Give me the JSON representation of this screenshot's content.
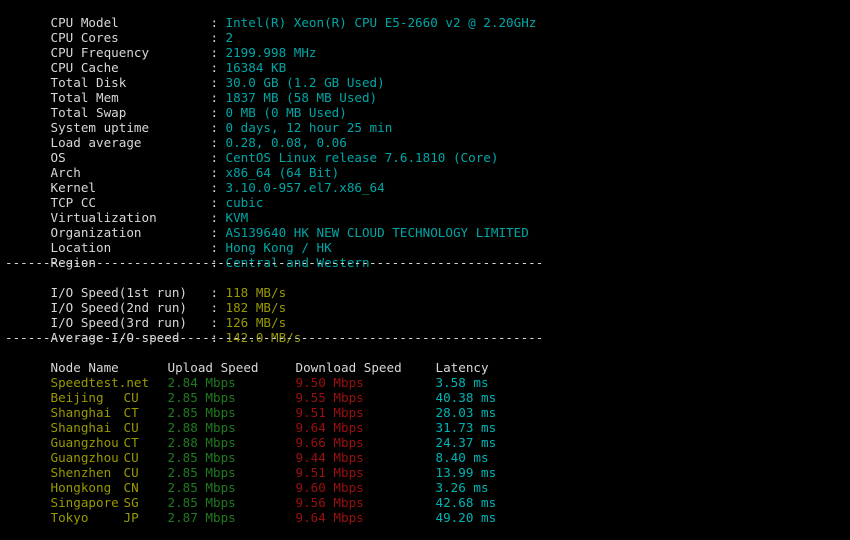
{
  "terminal": {
    "background": "#000000",
    "foreground": "#d8d8d8",
    "colors": {
      "label": "#d8d8d8",
      "info_value": "#00a6a6",
      "io_value": "#999900",
      "node_name": "#999900",
      "upload": "#1f7a1f",
      "download": "#9a0f0f",
      "latency": "#00b3b3",
      "separator": "#d8d8d8"
    }
  },
  "separator": "-----------------------------------------------------------------------",
  "system_info": {
    "separator_label": "colon",
    "rows": [
      {
        "label": "CPU Model",
        "colon": ":",
        "value": "Intel(R) Xeon(R) CPU E5-2660 v2 @ 2.20GHz"
      },
      {
        "label": "CPU Cores",
        "colon": ":",
        "value": "2"
      },
      {
        "label": "CPU Frequency",
        "colon": ":",
        "value": "2199.998 MHz"
      },
      {
        "label": "CPU Cache",
        "colon": ":",
        "value": "16384 KB"
      },
      {
        "label": "Total Disk",
        "colon": ":",
        "value": "30.0 GB (1.2 GB Used)"
      },
      {
        "label": "Total Mem",
        "colon": ":",
        "value": "1837 MB (58 MB Used)"
      },
      {
        "label": "Total Swap",
        "colon": ":",
        "value": "0 MB (0 MB Used)"
      },
      {
        "label": "System uptime",
        "colon": ":",
        "value": "0 days, 12 hour 25 min"
      },
      {
        "label": "Load average",
        "colon": ":",
        "value": "0.28, 0.08, 0.06"
      },
      {
        "label": "OS",
        "colon": ":",
        "value": "CentOS Linux release 7.6.1810 (Core)"
      },
      {
        "label": "Arch",
        "colon": ":",
        "value": "x86_64 (64 Bit)"
      },
      {
        "label": "Kernel",
        "colon": ":",
        "value": "3.10.0-957.el7.x86_64"
      },
      {
        "label": "TCP CC",
        "colon": ":",
        "value": "cubic"
      },
      {
        "label": "Virtualization",
        "colon": ":",
        "value": "KVM"
      },
      {
        "label": "Organization",
        "colon": ":",
        "value": "AS139640 HK NEW CLOUD TECHNOLOGY LIMITED"
      },
      {
        "label": "Location",
        "colon": ":",
        "value": "Hong Kong / HK"
      },
      {
        "label": "Region",
        "colon": ":",
        "value": "Central and Western"
      }
    ]
  },
  "io_test": {
    "rows": [
      {
        "label": "I/O Speed(1st run)",
        "colon": ":",
        "value": "118 MB/s"
      },
      {
        "label": "I/O Speed(2nd run)",
        "colon": ":",
        "value": "182 MB/s"
      },
      {
        "label": "I/O Speed(3rd run)",
        "colon": ":",
        "value": "126 MB/s"
      },
      {
        "label": "Average I/O speed",
        "colon": ":",
        "value": "142.0 MB/s"
      }
    ]
  },
  "speedtest": {
    "headers": {
      "node": "Node Name",
      "isp": "",
      "upload": "Upload Speed",
      "download": "Download Speed",
      "latency": "Latency"
    },
    "rows": [
      {
        "node": "Speedtest.net",
        "isp": "",
        "upload": "2.84 Mbps",
        "download": "9.50 Mbps",
        "latency": "3.58 ms"
      },
      {
        "node": "Beijing",
        "isp": "CU",
        "upload": "2.85 Mbps",
        "download": "9.55 Mbps",
        "latency": "40.38 ms"
      },
      {
        "node": "Shanghai",
        "isp": "CT",
        "upload": "2.85 Mbps",
        "download": "9.51 Mbps",
        "latency": "28.03 ms"
      },
      {
        "node": "Shanghai",
        "isp": "CU",
        "upload": "2.88 Mbps",
        "download": "9.64 Mbps",
        "latency": "31.73 ms"
      },
      {
        "node": "Guangzhou",
        "isp": "CT",
        "upload": "2.88 Mbps",
        "download": "9.66 Mbps",
        "latency": "24.37 ms"
      },
      {
        "node": "Guangzhou",
        "isp": "CU",
        "upload": "2.85 Mbps",
        "download": "9.44 Mbps",
        "latency": "8.40 ms"
      },
      {
        "node": "Shenzhen",
        "isp": "CU",
        "upload": "2.85 Mbps",
        "download": "9.51 Mbps",
        "latency": "13.99 ms"
      },
      {
        "node": "Hongkong",
        "isp": "CN",
        "upload": "2.85 Mbps",
        "download": "9.60 Mbps",
        "latency": "3.26 ms"
      },
      {
        "node": "Singapore",
        "isp": "SG",
        "upload": "2.85 Mbps",
        "download": "9.56 Mbps",
        "latency": "42.68 ms"
      },
      {
        "node": "Tokyo",
        "isp": "JP",
        "upload": "2.87 Mbps",
        "download": "9.64 Mbps",
        "latency": "49.20 ms"
      }
    ]
  }
}
